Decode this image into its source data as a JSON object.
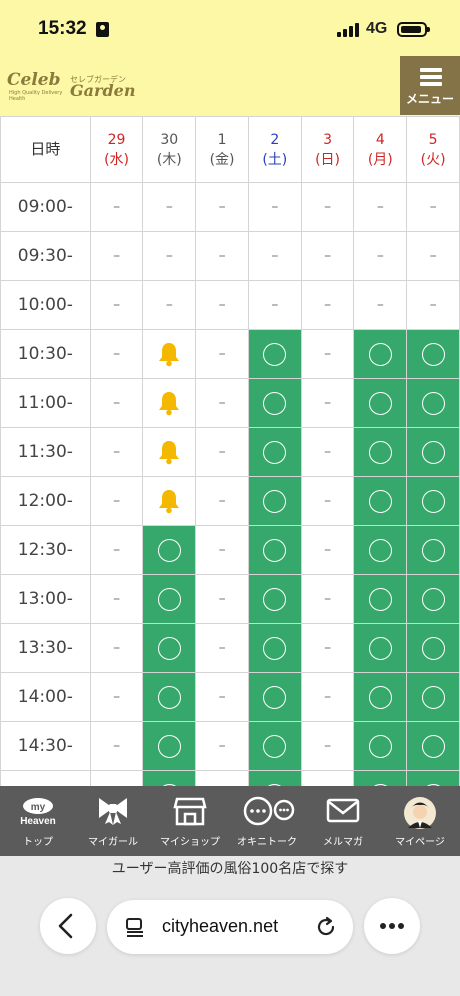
{
  "status": {
    "time": "15:32",
    "network": "4G"
  },
  "header": {
    "logo_main": "Celeb",
    "logo_sub": "セレブガーデン",
    "logo_garden": "Garden",
    "logo_tag": "High Quality Delivery Health",
    "menu_label": "メニュー"
  },
  "schedule": {
    "head_label": "日時",
    "days": [
      {
        "num": "29",
        "dow": "(水)",
        "color": "#d02525"
      },
      {
        "num": "30",
        "dow": "(木)",
        "color": "#555555"
      },
      {
        "num": "1",
        "dow": "(金)",
        "color": "#555555"
      },
      {
        "num": "2",
        "dow": "(土)",
        "color": "#2a3fb8"
      },
      {
        "num": "3",
        "dow": "(日)",
        "color": "#d02525"
      },
      {
        "num": "4",
        "dow": "(月)",
        "color": "#d02525"
      },
      {
        "num": "5",
        "dow": "(火)",
        "color": "#d02525"
      }
    ],
    "rows": [
      {
        "time": "09:00-",
        "cells": [
          "x",
          "x",
          "x",
          "x",
          "x",
          "x",
          "x"
        ]
      },
      {
        "time": "09:30-",
        "cells": [
          "x",
          "x",
          "x",
          "x",
          "x",
          "x",
          "x"
        ]
      },
      {
        "time": "10:00-",
        "cells": [
          "x",
          "x",
          "x",
          "x",
          "x",
          "x",
          "x"
        ]
      },
      {
        "time": "10:30-",
        "cells": [
          "x",
          "bell",
          "x",
          "ok",
          "x",
          "ok",
          "ok"
        ]
      },
      {
        "time": "11:00-",
        "cells": [
          "x",
          "bell",
          "x",
          "ok",
          "x",
          "ok",
          "ok"
        ]
      },
      {
        "time": "11:30-",
        "cells": [
          "x",
          "bell",
          "x",
          "ok",
          "x",
          "ok",
          "ok"
        ]
      },
      {
        "time": "12:00-",
        "cells": [
          "x",
          "bell",
          "x",
          "ok",
          "x",
          "ok",
          "ok"
        ]
      },
      {
        "time": "12:30-",
        "cells": [
          "x",
          "ok",
          "x",
          "ok",
          "x",
          "ok",
          "ok"
        ]
      },
      {
        "time": "13:00-",
        "cells": [
          "x",
          "ok",
          "x",
          "ok",
          "x",
          "ok",
          "ok"
        ]
      },
      {
        "time": "13:30-",
        "cells": [
          "x",
          "ok",
          "x",
          "ok",
          "x",
          "ok",
          "ok"
        ]
      },
      {
        "time": "14:00-",
        "cells": [
          "x",
          "ok",
          "x",
          "ok",
          "x",
          "ok",
          "ok"
        ]
      },
      {
        "time": "14:30-",
        "cells": [
          "x",
          "ok",
          "x",
          "ok",
          "x",
          "ok",
          "ok"
        ]
      },
      {
        "time": "",
        "cells": [
          "x",
          "ok",
          "x",
          "ok",
          "x",
          "ok",
          "ok"
        ]
      }
    ],
    "unavailable_mark": "–",
    "available_color": "#37a86b",
    "bell_color": "#f5b800"
  },
  "bottom_nav": {
    "items": [
      {
        "name": "top",
        "label": "トップ",
        "icon": "my-heaven-icon",
        "icon_line1": "my",
        "icon_line2": "Heaven"
      },
      {
        "name": "my-girl",
        "label": "マイガール",
        "icon": "ribbon-icon"
      },
      {
        "name": "my-shop",
        "label": "マイショップ",
        "icon": "shop-icon"
      },
      {
        "name": "okini-talk",
        "label": "オキニトーク",
        "icon": "chat-bubbles-icon"
      },
      {
        "name": "mail-magazine",
        "label": "メルマガ",
        "icon": "envelope-icon"
      },
      {
        "name": "my-page",
        "label": "マイページ",
        "icon": "avatar-icon"
      }
    ]
  },
  "browser": {
    "promo": "ユーザー高評価の風俗100名店で探す",
    "url": "cityheaven.net"
  }
}
